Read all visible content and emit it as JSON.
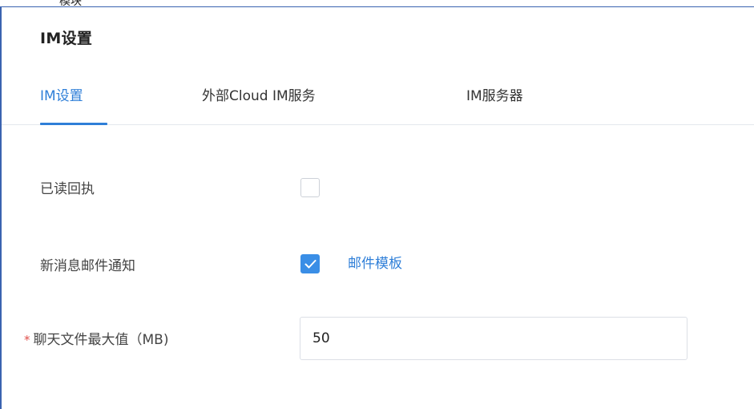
{
  "title": "IM设置",
  "top_fragment": "模块",
  "tabs": [
    {
      "label": "IM设置",
      "active": true
    },
    {
      "label": "外部Cloud IM服务",
      "active": false
    },
    {
      "label": "IM服务器",
      "active": false
    }
  ],
  "form": {
    "read_receipt": {
      "label": "已读回执",
      "checked": false
    },
    "new_message_email": {
      "label": "新消息邮件通知",
      "checked": true,
      "link_label": "邮件模板"
    },
    "max_file_size": {
      "required_mark": "*",
      "label": "聊天文件最大值（MB)",
      "value": "50"
    }
  },
  "colors": {
    "accent": "#2f7fd8",
    "checkbox_checked": "#3a8ee6",
    "required": "#e0504b",
    "frame_border": "#3a63b0"
  },
  "icons": {
    "checkmark": "check-icon"
  }
}
